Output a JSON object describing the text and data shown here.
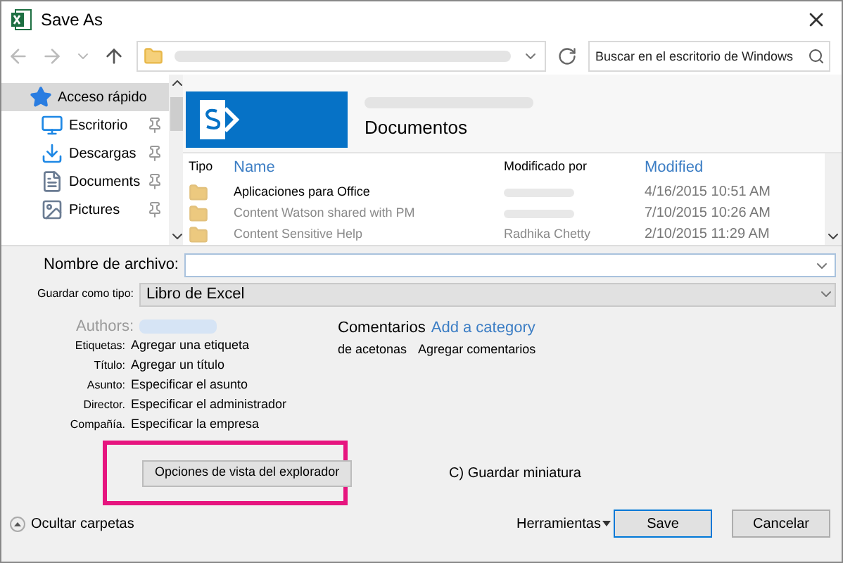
{
  "window": {
    "title": "Save As"
  },
  "nav": {
    "search": {
      "placeholder": "Buscar en el escritorio de Windows"
    }
  },
  "sidebar": {
    "items": [
      {
        "label": "Acceso rápido",
        "kind": "star",
        "selected": true,
        "pinned": false
      },
      {
        "label": "Escritorio",
        "kind": "desktop",
        "selected": false,
        "pinned": true
      },
      {
        "label": "Descargas",
        "kind": "download",
        "selected": false,
        "pinned": true
      },
      {
        "label": "Documents",
        "kind": "document",
        "selected": false,
        "pinned": true
      },
      {
        "label": "Pictures",
        "kind": "picture",
        "selected": false,
        "pinned": true
      }
    ]
  },
  "library": {
    "title": "Documentos",
    "columns": [
      {
        "label": "Tipo",
        "kind": "plain"
      },
      {
        "label": "Name",
        "kind": "link"
      },
      {
        "label": "Modificado por",
        "kind": "plain"
      },
      {
        "label": "Modified",
        "kind": "link"
      }
    ],
    "rows": [
      {
        "name": "Aplicaciones para Office",
        "modified": "4/16/2015 10:51 AM",
        "dimmed": false
      },
      {
        "name": "Content Watson shared with PM",
        "modified": "7/10/2015 10:26 AM",
        "dimmed": true
      },
      {
        "name": "Content Sensitive Help",
        "modified_by": "Radhika Chetty",
        "modified": "2/10/2015 11:29 AM",
        "dimmed": true
      }
    ]
  },
  "form": {
    "file_name": {
      "label": "Nombre de archivo:"
    },
    "save_type": {
      "label": "Guardar como tipo:",
      "value": "Libro de Excel"
    },
    "authors": {
      "label": "Authors:"
    },
    "properties": [
      {
        "label": "Etiquetas:",
        "value": "Agregar una etiqueta"
      },
      {
        "label": "Título:",
        "value": "Agregar un título"
      },
      {
        "label": "Asunto:",
        "value": "Especificar el asunto"
      },
      {
        "label": "Director.",
        "value": "Especificar el administrador"
      },
      {
        "label": "Compañía.",
        "value": "Especificar la empresa"
      }
    ],
    "comments": {
      "label_line1": "Comentarios",
      "label_line2": "de acetonas",
      "category_link": "Add a category",
      "value": "Agregar comentarios"
    },
    "explorer_button": "Opciones de vista del explorador",
    "thumbnail": "C) Guardar miniatura"
  },
  "footer": {
    "hide_folders": "Ocultar carpetas",
    "tools": "Herramientas",
    "save": "Save",
    "cancel": "Cancelar"
  }
}
